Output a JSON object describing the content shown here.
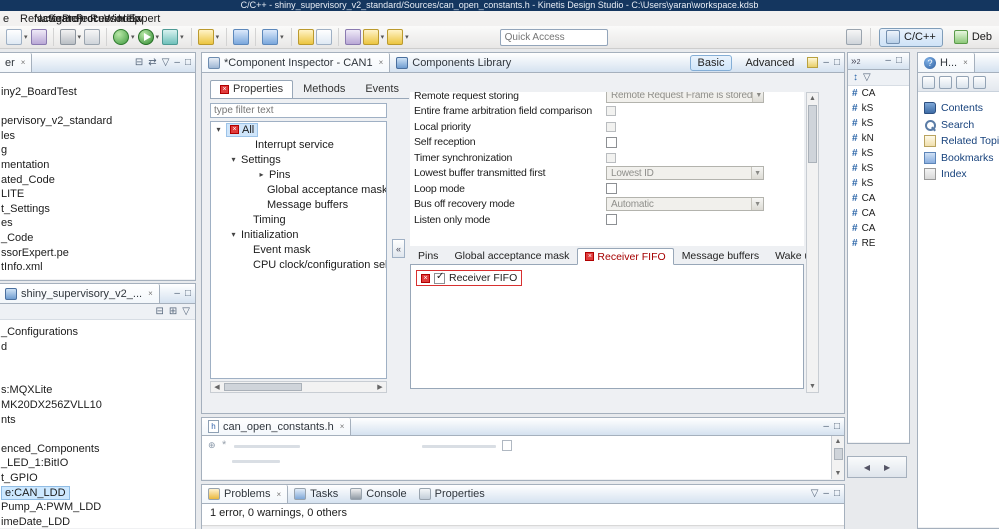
{
  "window": {
    "title": "C/C++ - shiny_supervisory_v2_standard/Sources/can_open_constants.h - Kinetis Design Studio - C:\\Users\\yaran\\workspace.kdsb"
  },
  "menu": {
    "items": [
      "e",
      "Refactor",
      "Navigate",
      "Search",
      "Project",
      "Processor Expert",
      "Run",
      "Window",
      "Help"
    ]
  },
  "toolbar": {
    "quick_access_placeholder": "Quick Access",
    "perspective_cpp": "C/C++",
    "perspective_debug": "Deb"
  },
  "project_explorer": {
    "tab_label": "er",
    "items": [
      "iny2_BoardTest",
      "",
      "pervisory_v2_standard",
      "les",
      "g",
      "mentation",
      "ated_Code",
      "LITE",
      "t_Settings",
      "es",
      "_Code",
      "ssorExpert.pe",
      "tInfo.xml"
    ]
  },
  "components_view": {
    "tab_label": "shiny_supervisory_v2_...",
    "items": [
      "_Configurations",
      "d",
      "",
      "",
      "s:MQXLite",
      "MK20DX256ZVLL10",
      "nts",
      "",
      "enced_Components",
      "_LED_1:BitIO",
      "t_GPIO",
      "e:CAN_LDD",
      "Pump_A:PWM_LDD",
      "imeDate_LDD"
    ],
    "selected_item": "e:CAN_LDD"
  },
  "inspector": {
    "tab_inspector": "*Component Inspector - CAN1",
    "tab_library": "Components Library",
    "mode_basic": "Basic",
    "mode_advanced": "Advanced",
    "tabs": {
      "properties": "Properties",
      "methods": "Methods",
      "events": "Events"
    },
    "filter_placeholder": "type filter text",
    "tree": [
      "All",
      "Interrupt service",
      "Settings",
      "Pins",
      "Global acceptance mask",
      "Message buffers",
      "Timing",
      "Initialization",
      "Event mask",
      "CPU clock/configuration selec"
    ],
    "props": [
      {
        "label": "Remote request storing",
        "value": "Remote Request Frame is stored",
        "enabled": false
      },
      {
        "label": "Entire frame arbitration field comparison",
        "checked": false,
        "enabled": false
      },
      {
        "label": "Local priority",
        "checked": false,
        "enabled": false
      },
      {
        "label": "Self reception",
        "checked": false,
        "enabled": true
      },
      {
        "label": "Timer synchronization",
        "checked": false,
        "enabled": false
      },
      {
        "label": "Lowest buffer transmitted first",
        "value": "Lowest ID",
        "enabled": false
      },
      {
        "label": "Loop mode",
        "checked": false,
        "enabled": true
      },
      {
        "label": "Bus off recovery mode",
        "value": "Automatic",
        "enabled": false
      },
      {
        "label": "Listen only mode",
        "checked": false,
        "enabled": true
      }
    ],
    "subtabs": [
      "Pins",
      "Global acceptance mask",
      "Receiver FIFO",
      "Message buffers",
      "Wake up"
    ],
    "fifo_checkbox_label": "Receiver FIFO",
    "fifo_checked": true
  },
  "editor": {
    "tab_label": "can_open_constants.h"
  },
  "problems": {
    "tabs": [
      "Problems",
      "Tasks",
      "Console",
      "Properties"
    ],
    "summary": "1 error, 0 warnings, 0 others"
  },
  "outline": {
    "items": [
      "CA",
      "kS",
      "kS",
      "kN",
      "kS",
      "kS",
      "kS",
      "CA",
      "CA",
      "CA",
      "RE"
    ]
  },
  "help": {
    "tab_label": "H...",
    "links": [
      "Contents",
      "Search",
      "Related Topics",
      "Bookmarks",
      "Index"
    ]
  },
  "colors": {
    "title_bar": "#14365f",
    "selection": "#cde8ff",
    "error_red": "#cc0000",
    "tab_gradient_top": "#ffffff",
    "tab_gradient_bottom": "#d5e2f0"
  }
}
